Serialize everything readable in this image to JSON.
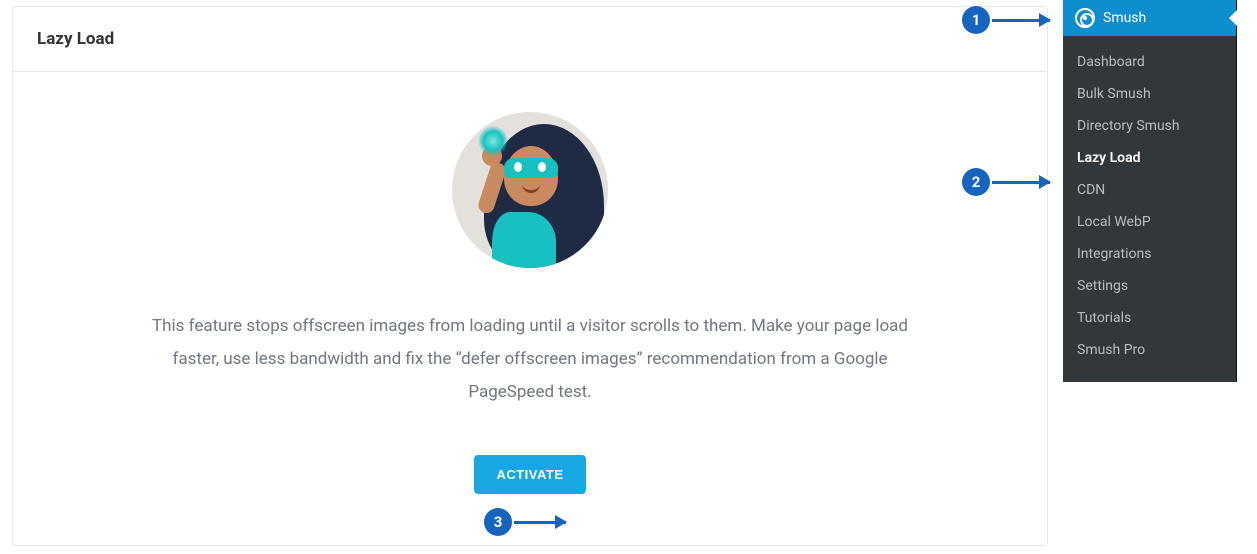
{
  "card": {
    "title": "Lazy Load",
    "description": "This feature stops offscreen images from loading until a visitor scrolls to them. Make your page load faster, use less bandwidth and fix the “defer offscreen images” recommendation from a Google PageSpeed test.",
    "activate_label": "ACTIVATE"
  },
  "annotations": {
    "one": "1",
    "two": "2",
    "three": "3"
  },
  "menu": {
    "header": "Smush",
    "items": [
      {
        "label": "Dashboard",
        "active": false
      },
      {
        "label": "Bulk Smush",
        "active": false
      },
      {
        "label": "Directory Smush",
        "active": false
      },
      {
        "label": "Lazy Load",
        "active": true
      },
      {
        "label": "CDN",
        "active": false
      },
      {
        "label": "Local WebP",
        "active": false
      },
      {
        "label": "Integrations",
        "active": false
      },
      {
        "label": "Settings",
        "active": false
      },
      {
        "label": "Tutorials",
        "active": false
      },
      {
        "label": "Smush Pro",
        "active": false
      }
    ]
  }
}
